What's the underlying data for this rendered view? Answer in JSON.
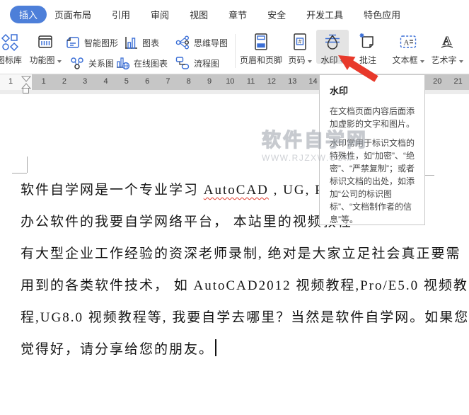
{
  "colors": {
    "accent_blue": "#4d7fd9",
    "icon_blue": "#3b6fd6",
    "arrow_red": "#e8392b",
    "spellcheck_red": "#e0392b",
    "ruler_gray": "#c6c6c6"
  },
  "tabs": {
    "active": "插入",
    "items": [
      "页面布局",
      "引用",
      "审阅",
      "视图",
      "章节",
      "安全",
      "开发工具",
      "特色应用"
    ]
  },
  "ribbon": {
    "icon_library": "图标库",
    "function_diagram": "功能图",
    "smart_graphics": "智能图形",
    "relation_diagram": "关系图",
    "chart": "图表",
    "online_chart": "在线图表",
    "mind_map": "思维导图",
    "flowchart": "流程图",
    "header_footer": "页眉和页脚",
    "page_number": "页码",
    "watermark": "水印",
    "comment": "批注",
    "text_box": "文本框",
    "word_art": "艺术字"
  },
  "ruler": {
    "margin_number": "1",
    "numbers": [
      "1",
      "2",
      "3",
      "4",
      "5",
      "6",
      "7",
      "8",
      "9",
      "10",
      "11",
      "12",
      "13",
      "14",
      "20",
      "21"
    ]
  },
  "tooltip": {
    "title": "水印",
    "body1": "在文档页面内容后面添加虚影的文字和图片。",
    "body2": "水印常用于标识文档的特殊性，如“加密”、“绝密”、“严禁复制”；或者标识文档的出处，如添加“公司的标识图标”、“文档制作者的信息”等。"
  },
  "document": {
    "line1_pre": "软件自学网是一个专业学习 ",
    "line1_misspelled": "AutoCAD",
    "line1_post": " , UG, Pro/E, PS",
    "line2": "办公软件的我要自学网络平台， 本站里的视频教程",
    "line3": "有大型企业工作经验的资深老师录制, 绝对是大家立足社会真正要需",
    "line4": "用到的各类软件技术， 如 AutoCAD2012 视频教程,Pro/E5.0 视频教",
    "line5": "程,UG8.0 视频教程等, 我要自学去哪里？当然是软件自学网。如果您",
    "line6": "觉得好，请分享给您的朋友。"
  },
  "watermark_overlay": {
    "title": "软件自学网",
    "url": "www.rjzxw.com"
  }
}
